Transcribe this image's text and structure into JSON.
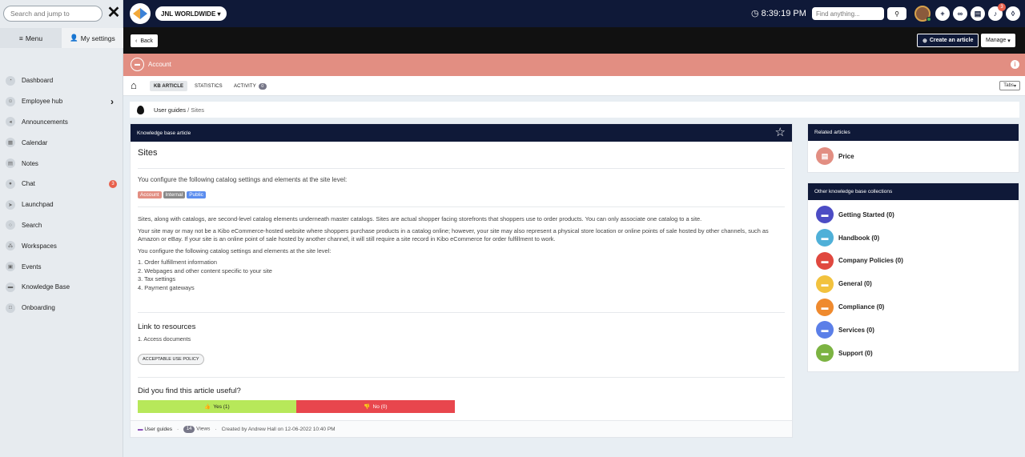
{
  "sidebar": {
    "search_placeholder": "Search and jump to",
    "menu_label": "Menu",
    "settings_label": "My settings",
    "items": [
      {
        "label": "Dashboard"
      },
      {
        "label": "Employee hub"
      },
      {
        "label": "Announcements"
      },
      {
        "label": "Calendar"
      },
      {
        "label": "Notes"
      },
      {
        "label": "Chat",
        "badge": "3"
      },
      {
        "label": "Launchpad"
      },
      {
        "label": "Search"
      },
      {
        "label": "Workspaces"
      },
      {
        "label": "Events"
      },
      {
        "label": "Knowledge Base"
      },
      {
        "label": "Onboarding"
      }
    ]
  },
  "header": {
    "org_name": "JNL WORLDWIDE",
    "time": "8:39:19 PM",
    "find_placeholder": "Find anything...",
    "notification_count": "3"
  },
  "actions": {
    "back_label": "Back",
    "create_label": "Create an article",
    "manage_label": "Manage"
  },
  "context": {
    "title": "Account"
  },
  "tabs": {
    "items": [
      {
        "label": "KB ARTICLE"
      },
      {
        "label": "STATISTICS"
      },
      {
        "label": "ACTIVITY",
        "count": "0"
      }
    ],
    "dropdown_label": "Tabs"
  },
  "breadcrumb": {
    "parent": "User guides",
    "separator": "/",
    "current": "Sites"
  },
  "article": {
    "header": "Knowledge base article",
    "title": "Sites",
    "lead": "You configure the following catalog settings and elements at the site level:",
    "tags": [
      {
        "label": "Account",
        "color": "#e28e82"
      },
      {
        "label": "Internal",
        "color": "#8a8a8a"
      },
      {
        "label": "Public",
        "color": "#5b8def"
      }
    ],
    "paragraphs": [
      "Sites, along with catalogs, are second-level catalog elements underneath master catalogs. Sites are actual shopper facing storefronts that shoppers use to order products. You can only associate one catalog to a site.",
      "Your site may or may not be a Kibo eCommerce-hosted website where shoppers purchase products in a catalog online; however, your site may also represent a physical store location or online points of sale hosted by other channels, such as Amazon or eBay. If your site is an online point of sale hosted by another channel, it will still require a site record in Kibo eCommerce for order fulfillment to work.",
      "You configure the following catalog settings and elements at the site level:"
    ],
    "list": [
      "1. Order fulfillment information",
      "2. Webpages and other content specific to your site",
      "3. Tax settings",
      "4. Payment gateways"
    ],
    "resources_title": "Link to resources",
    "resources_item": "1. Access documents",
    "policy_label": "ACCEPTABLE USE POLICY",
    "useful_title": "Did you find this article useful?",
    "yes_label": "Yes (1)",
    "no_label": "No (0)",
    "footer": {
      "collection": "User guides",
      "views_count": "14",
      "views_label": "Views",
      "created": "Created by Andrew Hall on 12-06-2022 10:40 PM"
    }
  },
  "related": {
    "header": "Related articles",
    "items": [
      {
        "label": "Price",
        "color": "#e28e82"
      }
    ]
  },
  "collections": {
    "header": "Other knowledge base collections",
    "items": [
      {
        "label": "Getting Started (0)",
        "color": "#4c4cc4"
      },
      {
        "label": "Handbook (0)",
        "color": "#4fb0d8"
      },
      {
        "label": "Company Policies (0)",
        "color": "#e0483f"
      },
      {
        "label": "General (0)",
        "color": "#f2c23e"
      },
      {
        "label": "Compliance (0)",
        "color": "#ef8a2e"
      },
      {
        "label": "Services (0)",
        "color": "#5b7fe8"
      },
      {
        "label": "Support (0)",
        "color": "#7cb342"
      }
    ]
  }
}
